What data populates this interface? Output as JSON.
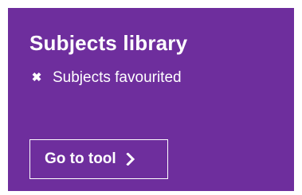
{
  "card": {
    "title": "Subjects library",
    "status": {
      "icon": "close-icon",
      "icon_glyph": "✖",
      "text": "Subjects favourited"
    },
    "button": {
      "label": "Go to tool",
      "icon": "chevron-right-icon"
    }
  },
  "colors": {
    "card_background": "#6e2e9d",
    "text": "#ffffff"
  }
}
